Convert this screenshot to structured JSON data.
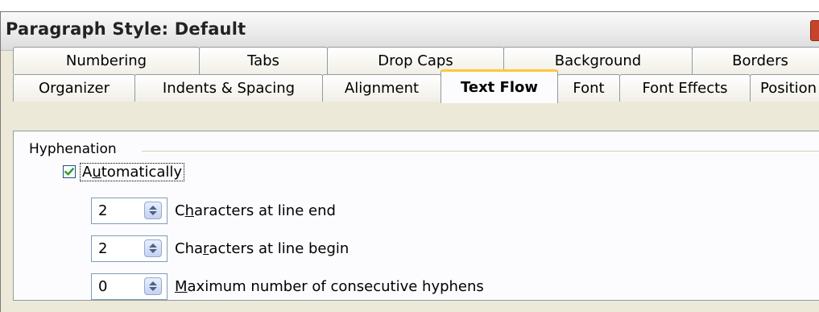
{
  "window": {
    "title": "Paragraph Style: Default"
  },
  "tabs_back": [
    {
      "label": "Numbering"
    },
    {
      "label": "Tabs"
    },
    {
      "label": "Drop Caps"
    },
    {
      "label": "Background"
    },
    {
      "label": "Borders"
    }
  ],
  "tabs_front": [
    {
      "label": "Organizer"
    },
    {
      "label": "Indents & Spacing"
    },
    {
      "label": "Alignment"
    },
    {
      "label": "Text Flow",
      "active": true
    },
    {
      "label": "Font"
    },
    {
      "label": "Font Effects"
    },
    {
      "label": "Position"
    }
  ],
  "hyphenation": {
    "group_label": "Hyphenation",
    "automatically": {
      "label_pre": "A",
      "label_mnemonic": "u",
      "label_post": "tomatically",
      "checked": true
    },
    "fields": [
      {
        "value": "2",
        "label_pre": "C",
        "label_mnemonic": "h",
        "label_post": "aracters at line end"
      },
      {
        "value": "2",
        "label_pre": "Cha",
        "label_mnemonic": "r",
        "label_post": "acters at line begin"
      },
      {
        "value": "0",
        "label_pre": "",
        "label_mnemonic": "M",
        "label_post": "aximum number of consecutive hyphens"
      }
    ]
  },
  "colors": {
    "active_tab_accent": "#ffc83c",
    "checkmark": "#21a121",
    "close_button": "#c6432c"
  },
  "icons": {
    "checkbox": "check-icon",
    "spinner": "spin-updown-icon",
    "close": "close-icon"
  }
}
